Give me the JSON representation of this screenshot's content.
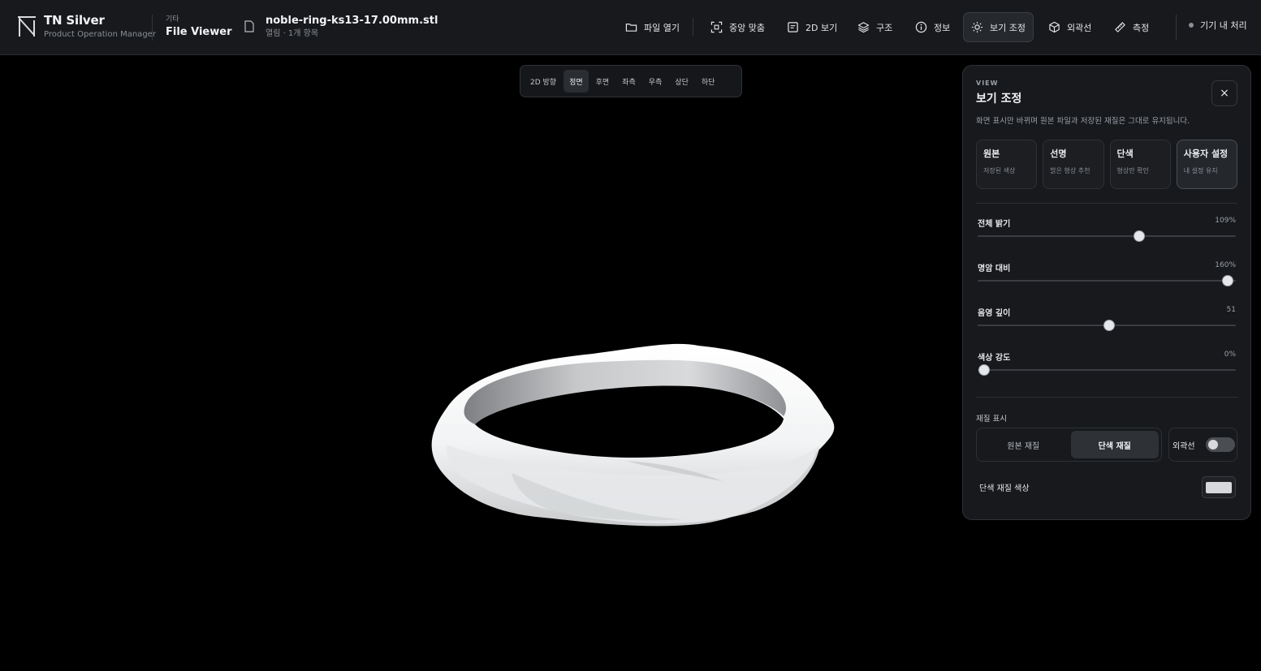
{
  "brand": {
    "name": "TN Silver",
    "sub": "Product Operation Manager"
  },
  "section": {
    "kicker": "기타",
    "title": "File Viewer"
  },
  "file": {
    "name": "noble-ring-ks13-17.00mm.stl",
    "meta": "열림 · 1개 항목"
  },
  "toolbar": {
    "open": "파일 열기",
    "center": "중앙 맞춤",
    "view2d": "2D 보기",
    "structure": "구조",
    "info": "정보",
    "adjust": "보기 조정",
    "outline": "외곽선",
    "measure": "측정",
    "status": "기기 내 처리"
  },
  "view_bar": {
    "items": [
      "2D 방향",
      "정면",
      "후면",
      "좌측",
      "우측",
      "상단",
      "하단"
    ],
    "active": "정면"
  },
  "panel": {
    "kicker": "VIEW",
    "title": "보기 조정",
    "desc": "화면 표시만 바뀌며 원본 파일과 저장된 재질은 그대로 유지됩니다.",
    "close": "×",
    "presets": [
      {
        "name": "원본",
        "sub": "저장된 색상"
      },
      {
        "name": "선명",
        "sub": "밝은 형상 추천"
      },
      {
        "name": "단색",
        "sub": "형상만 확인"
      },
      {
        "name": "사용자 설정",
        "sub": "내 설정 유지"
      }
    ],
    "active_preset": "사용자 설정",
    "sliders": [
      {
        "label": "전체 밝기",
        "value": "109%",
        "fraction": 0.625
      },
      {
        "label": "명암 대비",
        "value": "160%",
        "fraction": 0.97
      },
      {
        "label": "음영 깊이",
        "value": "51",
        "fraction": 0.51
      },
      {
        "label": "색상 강도",
        "value": "0%",
        "fraction": 0.025
      }
    ],
    "material": {
      "label": "재질 표시",
      "original": "원본 재질",
      "solid": "단색 재질",
      "active": "단색 재질",
      "outline_label": "외곽선",
      "outline_on": false
    },
    "color": {
      "label": "단색 재질 색상",
      "value": "#d6d8dc"
    }
  }
}
